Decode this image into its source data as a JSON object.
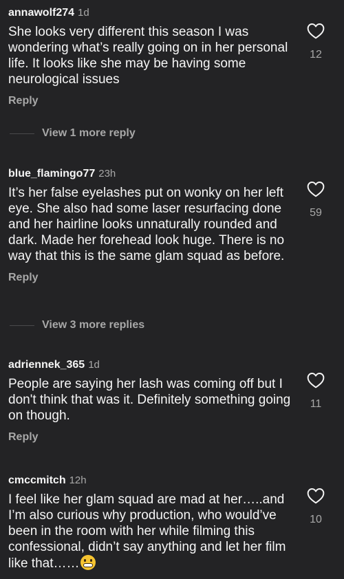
{
  "comments": [
    {
      "username": "annawolf274",
      "time": "1d",
      "text": "She looks very different this season I was wondering what’s really going on in her personal life. It looks like she may be having some neurological issues",
      "reply_label": "Reply",
      "likes": "12",
      "view_more": "View 1 more reply"
    },
    {
      "username": "blue_flamingo77",
      "time": "23h",
      "text": "It’s her false eyelashes put on wonky on her left eye. She also had some laser resurfacing done and her hairline looks unnaturally rounded and dark. Made her forehead look huge. There is no way that this is the same glam squad as before.",
      "reply_label": "Reply",
      "likes": "59",
      "view_more": "View 3 more replies"
    },
    {
      "username": "adriennek_365",
      "time": "1d",
      "text": "People are saying her lash was coming off but I don't think that was it. Definitely something going on though.",
      "reply_label": "Reply",
      "likes": "11"
    },
    {
      "username": "cmccmitch",
      "time": "12h",
      "text": "I feel like her glam squad are mad at her…..and I’m also curious why production, who would’ve been in the room with her while filming this confessional, didn’t say anything and let her film like that……",
      "likes": "10",
      "emoji": "grimacing-face"
    }
  ],
  "icons": {
    "like": "heart-outline-icon"
  },
  "colors": {
    "background": "#232325",
    "text": "#f5f5f5",
    "muted": "#a8a8a8"
  }
}
